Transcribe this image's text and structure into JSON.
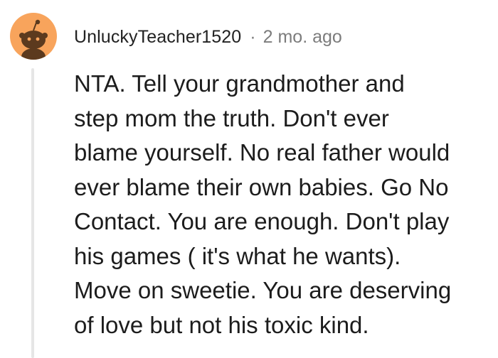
{
  "comment": {
    "username": "UnluckyTeacher1520",
    "separator": "·",
    "timestamp": "2 mo. ago",
    "avatar_icon": "reddit-snoo-avatar-icon",
    "avatar_color": "#f8a45c",
    "body_lines": [
      "NTA. Tell your grandmother and",
      "step mom the truth. Don't ever",
      "blame yourself. No real father would",
      "ever blame their own babies. Go No",
      "Contact. You are enough. Don't play",
      "his games ( it's what he wants).",
      "Move on sweetie. You are deserving",
      "of love but not his toxic kind."
    ]
  }
}
